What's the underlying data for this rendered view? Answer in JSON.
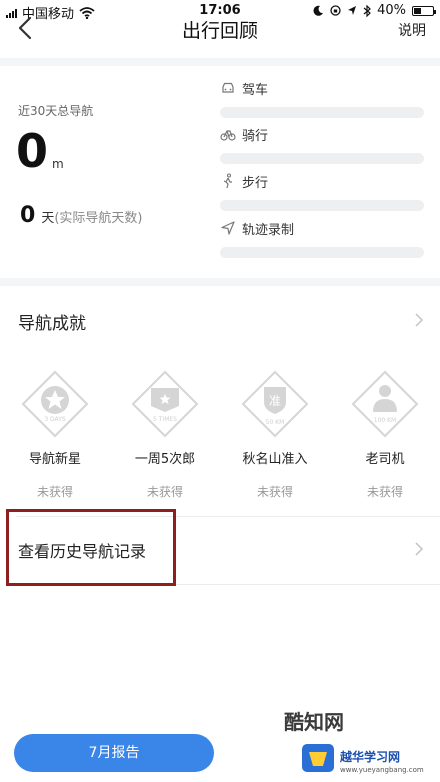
{
  "status_bar": {
    "carrier": "中国移动",
    "time": "17:06",
    "battery_percent": "40%",
    "battery_level": 0.4
  },
  "nav": {
    "title": "出行回顾",
    "help_label": "说明"
  },
  "summary": {
    "label": "近30天总导航",
    "distance_value": "0",
    "distance_unit": "m",
    "days_value": "0",
    "days_unit": "天",
    "days_note": "(实际导航天数)"
  },
  "modes": [
    {
      "label": "驾车",
      "icon": "car-icon"
    },
    {
      "label": "骑行",
      "icon": "bicycle-icon"
    },
    {
      "label": "步行",
      "icon": "walk-icon"
    },
    {
      "label": "轨迹录制",
      "icon": "location-arrow-icon"
    }
  ],
  "achievements": {
    "title": "导航成就",
    "badges": [
      {
        "name": "导航新星",
        "status": "未获得",
        "badge_text": "3 DAYS",
        "icon": "star-badge-icon"
      },
      {
        "name": "一周5次郎",
        "status": "未获得",
        "badge_text": "5 TIMES",
        "icon": "flag-badge-icon"
      },
      {
        "name": "秋名山准入",
        "status": "未获得",
        "badge_text": "50 KM",
        "badge_glyph": "准",
        "icon": "shield-badge-icon"
      },
      {
        "name": "老司机",
        "status": "未获得",
        "badge_text": "100 KM",
        "icon": "driver-badge-icon"
      }
    ]
  },
  "history": {
    "label": "查看历史导航记录"
  },
  "report": {
    "label": "7月报告"
  },
  "watermark": {
    "brand": "酷知网",
    "site_name": "越华学习网",
    "url": "www.yueyangbang.com"
  },
  "colors": {
    "accent": "#3a86e8",
    "highlight": "#8e1f1f",
    "badge_gray": "#d5d5d5"
  }
}
